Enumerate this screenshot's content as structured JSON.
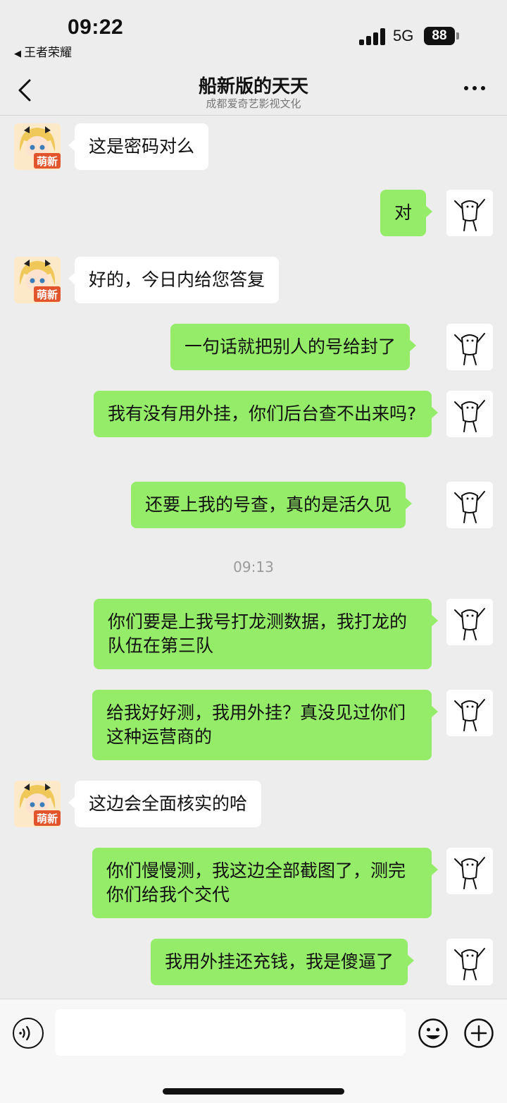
{
  "status_bar": {
    "time": "09:22",
    "back_app": "王者荣耀",
    "network": "5G",
    "battery": "88"
  },
  "header": {
    "title": "船新版的天天",
    "subtitle": "成都爱奇艺影视文化",
    "back_icon": "chevron-left-icon",
    "more_icon": "more-dots-icon"
  },
  "messages": [
    {
      "side": "left",
      "text": "这是密码对么"
    },
    {
      "side": "right",
      "text": "对"
    },
    {
      "side": "left",
      "text": "好的，今日内给您答复"
    },
    {
      "side": "right",
      "text": "一句话就把别人的号给封了"
    },
    {
      "side": "right",
      "text": "我有没有用外挂，你们后台查不出来吗?"
    },
    {
      "side": "right",
      "text": "还要上我的号查，真的是活久见"
    },
    {
      "type": "time",
      "text": "09:13"
    },
    {
      "side": "right",
      "text": "你们要是上我号打龙测数据，我打龙的队伍在第三队"
    },
    {
      "side": "right",
      "text": "给我好好测，我用外挂？真没见过你们这种运营商的"
    },
    {
      "side": "left",
      "text": "这边会全面核实的哈"
    },
    {
      "side": "right",
      "text": "你们慢慢测，我这边全部截图了，测完你们给我个交代"
    },
    {
      "side": "right",
      "text": "我用外挂还充钱，我是傻逼了"
    }
  ],
  "avatar_badge": "萌新",
  "colors": {
    "background": "#ededed",
    "bubble_self": "#95ec69",
    "bubble_other": "#ffffff"
  }
}
